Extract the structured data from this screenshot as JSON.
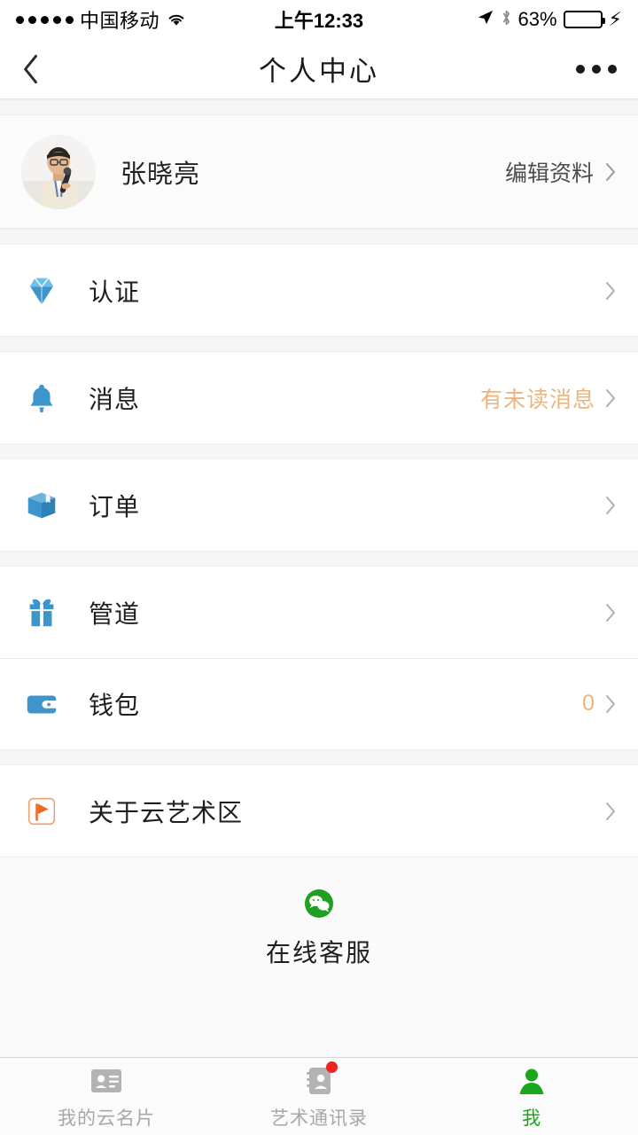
{
  "status_bar": {
    "signal_dots": 5,
    "carrier": "中国移动",
    "wifi_icon": "wifi-icon",
    "time": "上午12:33",
    "location_icon": "location-arrow-icon",
    "bluetooth_icon": "bluetooth-icon",
    "battery_percent": "63%",
    "battery_level": 63,
    "charging_icon": "lightning-bolt-icon"
  },
  "nav": {
    "back_icon": "back-chevron-icon",
    "title": "个人中心",
    "more_icon": "more-dots-icon"
  },
  "profile": {
    "avatar_icon": "user-avatar-photo",
    "name": "张晓亮",
    "edit_label": "编辑资料",
    "chevron_icon": "chevron-right-icon"
  },
  "menu_groups": [
    {
      "rows": [
        {
          "icon": "diamond-icon",
          "label": "认证",
          "value": ""
        }
      ]
    },
    {
      "rows": [
        {
          "icon": "bell-icon",
          "label": "消息",
          "value": "有未读消息"
        }
      ]
    },
    {
      "rows": [
        {
          "icon": "package-box-icon",
          "label": "订单",
          "value": ""
        }
      ]
    },
    {
      "rows": [
        {
          "icon": "gift-icon",
          "label": "管道",
          "value": ""
        },
        {
          "icon": "wallet-icon",
          "label": "钱包",
          "value": "0"
        }
      ]
    },
    {
      "rows": [
        {
          "icon": "flag-icon",
          "label": "关于云艺术区",
          "value": ""
        }
      ]
    }
  ],
  "service": {
    "icon": "wechat-chat-icon",
    "label": "在线客服"
  },
  "tabbar": {
    "tabs": [
      {
        "icon": "id-card-icon",
        "label": "我的云名片",
        "active": false,
        "badge": false
      },
      {
        "icon": "contacts-book-icon",
        "label": "艺术通讯录",
        "active": false,
        "badge": true
      },
      {
        "icon": "person-icon",
        "label": "我",
        "active": true,
        "badge": false
      }
    ]
  },
  "colors": {
    "accent_blue": "#3d95cc",
    "accent_orange": "#eab680",
    "flag_orange": "#f26522",
    "active_green": "#1aa81a",
    "badge_red": "#f02121",
    "battery_green": "#3cd139"
  }
}
